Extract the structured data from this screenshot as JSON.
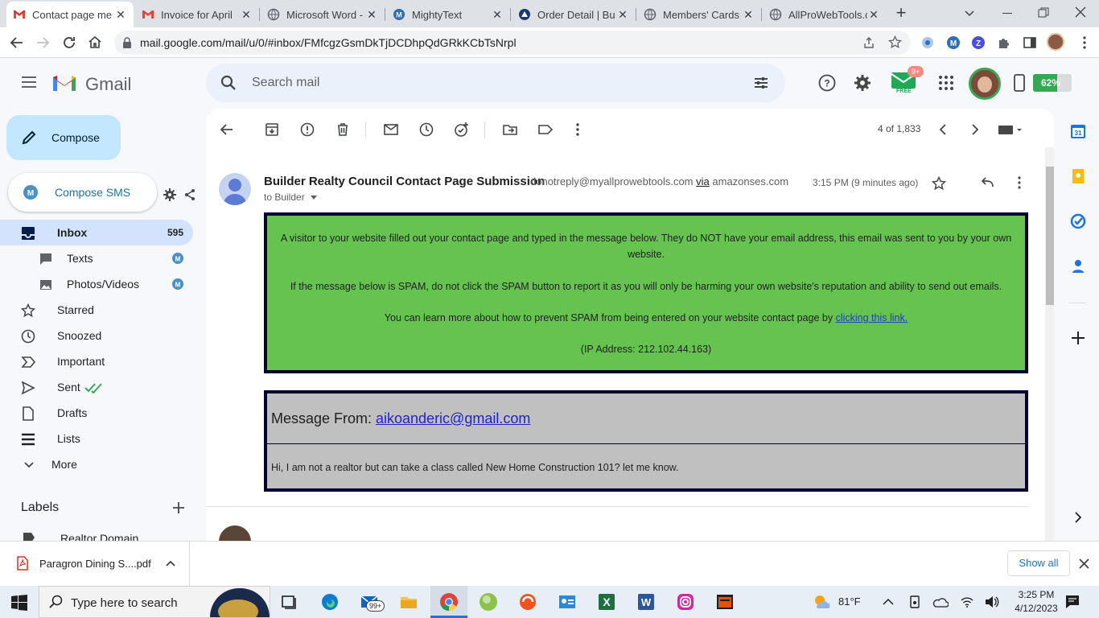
{
  "browser": {
    "tabs": [
      {
        "title": "Contact page me",
        "icon": "gmail-icon",
        "active": true
      },
      {
        "title": "Invoice for April",
        "icon": "gmail-icon"
      },
      {
        "title": "Microsoft Word -",
        "icon": "globe-icon"
      },
      {
        "title": "MightyText",
        "icon": "mightytext-icon"
      },
      {
        "title": "Order Detail | Bu",
        "icon": "globe-icon"
      },
      {
        "title": "Members' Cards",
        "icon": "globe-icon"
      },
      {
        "title": "AllProWebTools.c",
        "icon": "globe-icon"
      }
    ],
    "url": "mail.google.com/mail/u/0/#inbox/FMfcgzGsmDkTjDCDhpQdGRkKCbTsNrpl",
    "battery": "62%",
    "badge": "9+",
    "free_label": "FREE"
  },
  "gmail": {
    "logo_text": "Gmail",
    "search_placeholder": "Search mail",
    "compose_label": "Compose",
    "compose_sms_label": "Compose SMS",
    "nav": [
      {
        "label": "Inbox",
        "count": "595",
        "icon": "inbox-icon",
        "selected": true
      },
      {
        "label": "Texts",
        "icon": "chat-icon",
        "sub": true
      },
      {
        "label": "Photos/Videos",
        "icon": "photo-icon",
        "sub": true
      },
      {
        "label": "Starred",
        "icon": "star-icon"
      },
      {
        "label": "Snoozed",
        "icon": "clock-icon"
      },
      {
        "label": "Important",
        "icon": "important-icon"
      },
      {
        "label": "Sent",
        "icon": "send-icon"
      },
      {
        "label": "Drafts",
        "icon": "draft-icon"
      },
      {
        "label": "Lists",
        "icon": "list-icon"
      },
      {
        "label": "More",
        "icon": "chevron-down-icon"
      }
    ],
    "labels_heading": "Labels",
    "partial_label": "Realtor Domain",
    "pagination": "4 of 1,833"
  },
  "email": {
    "subject": "Builder Realty Council Contact Page Submission",
    "from_email": "donotreply@myallprowebtools.com",
    "via_label": "via",
    "via_domain": "amazonses.com",
    "to": "to Builder",
    "time": "3:15 PM (9 minutes ago)",
    "notice_p1": "A visitor to your website filled out your contact page and typed in the message below. They do NOT have your email address, this email was sent to you by your own website.",
    "notice_p2": "If the message below is SPAM, do not click the SPAM button to report it as you will only be harming your own website's reputation and ability to send out emails.",
    "notice_p3": "You can learn more about how to prevent SPAM from being entered on your website contact page by",
    "notice_link": "clicking this link.",
    "ip": "(IP Address: 212.102.44.163)",
    "message_from_label": "Message From:",
    "message_from_email": "aikoanderic@gmail.com",
    "message_body": "Hi, I am not a realtor but can take a class called New Home Construction 101? let me know.",
    "colors": {
      "notice_bg": "#66c34f",
      "message_bg": "#c0c0c0",
      "border": "#000033",
      "link": "#2222cc"
    }
  },
  "downloads": {
    "file": "Paragron Dining S....pdf",
    "show_all": "Show all"
  },
  "taskbar": {
    "search_placeholder": "Type here to search",
    "mail_badge": "99+",
    "weather": "81°F",
    "time": "3:25 PM",
    "date": "4/12/2023"
  }
}
